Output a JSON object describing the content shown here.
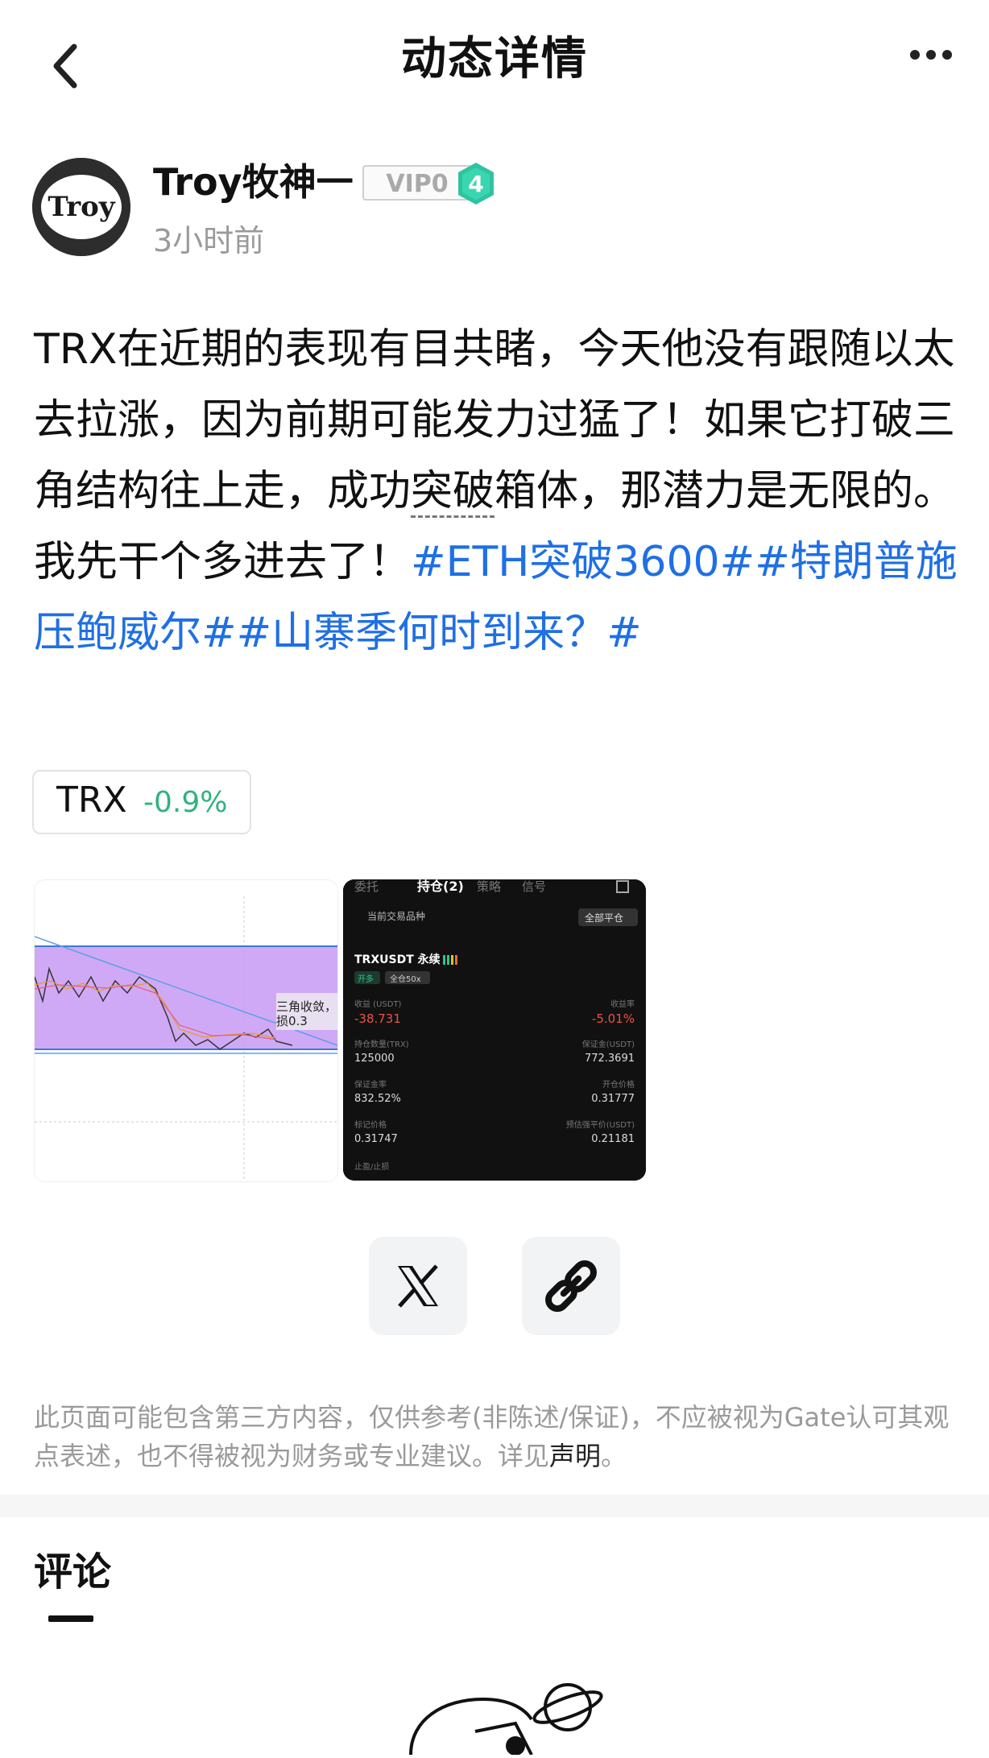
{
  "header": {
    "title": "动态详情"
  },
  "author": {
    "name": "Troy牧神一",
    "avatar_text": "Troy",
    "vip": "VIP0",
    "level": "4",
    "time": "3小时前"
  },
  "post": {
    "text_part1": "TRX在近期的表现有目共睹，今天他没有跟随以太去拉涨，因为前期可能发力过猛了！如果它打破三角结构往上走，成功",
    "text_dotted": "突破",
    "text_part2": "箱体，那潜力是无限的。我先干个多进去了！",
    "hashtags": "#ETH突破3600##特朗普施压鲍威尔##山寨季何时到来？#"
  },
  "coin": {
    "symbol": "TRX",
    "change": "-0.9%",
    "change_color": "#30b27d"
  },
  "thumb1": {
    "annotation_line1": "三角收敛，",
    "annotation_line2": "损0.3"
  },
  "thumb2": {
    "tabs": [
      "委托",
      "持仓(2)",
      "策略",
      "信号"
    ],
    "filter_label": "当前交易品种",
    "close_all": "全部平仓",
    "pair": "TRXUSDT 永续",
    "tag1": "开多",
    "tag2": "全仓50x",
    "pnl_label": "收益 (USDT)",
    "pnl_value": "-38.731",
    "roe_label": "收益率",
    "roe_value": "-5.01%",
    "qty_label": "持仓数量(TRX)",
    "qty_value": "125000",
    "margin_label": "保证金(USDT)",
    "margin_value": "772.3691",
    "ratio_label": "保证金率",
    "ratio_value": "832.52%",
    "entry_label": "开仓价格",
    "entry_value": "0.31777",
    "mark_label": "标记价格",
    "mark_value": "0.31747",
    "liq_label": "预估强平价(USDT)",
    "liq_value": "0.21181",
    "tpsl_label": "止盈/止损"
  },
  "share": {
    "x_icon": "x-logo-icon",
    "link_icon": "link-icon"
  },
  "disclaimer": {
    "text": "此页面可能包含第三方内容，仅供参考(非陈述/保证)，不应被视为Gate认可其观点表述，也不得被视为财务或专业建议。详见",
    "link": "声明",
    "end": "。"
  },
  "comments": {
    "title": "评论"
  }
}
